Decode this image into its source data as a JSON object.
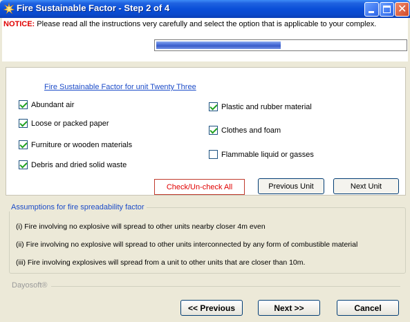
{
  "window": {
    "title": "Fire Sustainable Factor - Step 2 of 4"
  },
  "notice": {
    "label": "NOTICE:",
    "text": "Please read all the instructions very carefully and select the option that is applicable to your complex."
  },
  "progress": {
    "value": 0.5
  },
  "factors": {
    "title": "Fire Sustainable Factor for unit Twenty Three",
    "items": [
      {
        "label": "Abundant air",
        "checked": true
      },
      {
        "label": "Loose or packed paper",
        "checked": true
      },
      {
        "label": "Furniture or wooden materials",
        "checked": true
      },
      {
        "label": "Debris and dried solid waste",
        "checked": true
      },
      {
        "label": "Plastic and rubber material",
        "checked": true
      },
      {
        "label": "Clothes and foam",
        "checked": true
      },
      {
        "label": "Flammable liquid or gasses",
        "checked": false
      }
    ],
    "check_all_label": "Check/Un-check All",
    "previous_unit_label": "Previous Unit",
    "next_unit_label": "Next Unit"
  },
  "assumptions": {
    "title": "Assumptions for fire spreadability factor",
    "items": [
      "(i) Fire involving no explosive will spread to other units nearby closer 4m even",
      "(ii) Fire involving no explosive will spread to other units interconnected by any form of combustible material",
      "(iii) Fire involving explosives will spread from a unit to other units that are closer than 10m."
    ]
  },
  "brand": "Dayosoft®",
  "nav": {
    "previous_label": "<< Previous",
    "next_label": "Next >>",
    "cancel_label": "Cancel"
  },
  "colors": {
    "titlebar": "#0a4fd8",
    "notice_label": "#e00000",
    "link": "#1b4bc8",
    "check": "#21a121"
  },
  "icons": {
    "title_icon": "fire-sparkle-icon"
  }
}
